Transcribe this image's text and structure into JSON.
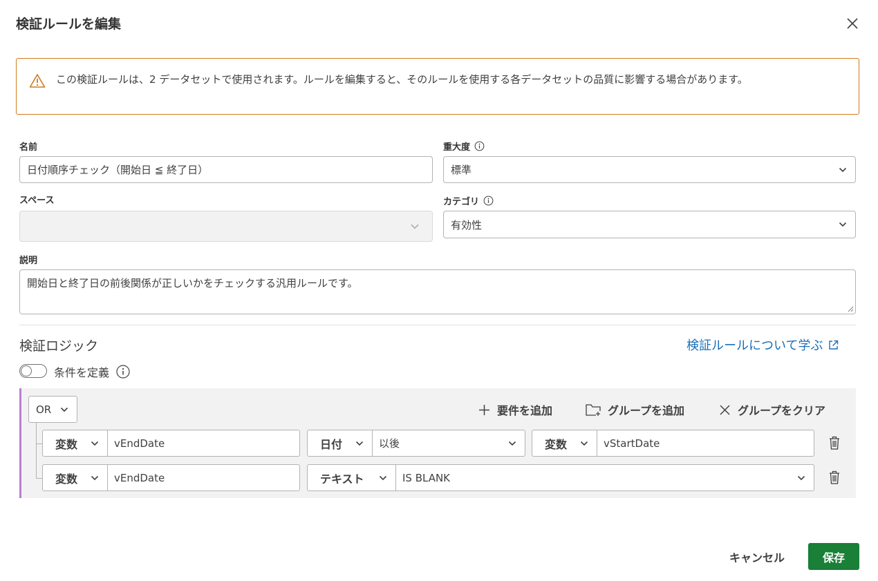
{
  "dialog": {
    "title": "検証ルールを編集"
  },
  "warning": {
    "text": "この検証ルールは、2 データセットで使用されます。ルールを編集すると、そのルールを使用する各データセットの品質に影響する場合があります。"
  },
  "form": {
    "name_label": "名前",
    "name_value": "日付順序チェック（開始日 ≦ 終了日）",
    "severity_label": "重大度",
    "severity_value": "標準",
    "space_label": "スペース",
    "space_value": "",
    "category_label": "カテゴリ",
    "category_value": "有効性",
    "description_label": "説明",
    "description_value": "開始日と終了日の前後関係が正しいかをチェックする汎用ルールです。"
  },
  "logic": {
    "title": "検証ロジック",
    "learn_link": "検証ルールについて学ぶ",
    "toggle_label": "条件を定義",
    "toggle_on": false,
    "operator": "OR",
    "add_requirement": "要件を追加",
    "add_group": "グループを追加",
    "clear_group": "グループをクリア",
    "rows": [
      {
        "left_type": "変数",
        "left_value": "vEndDate",
        "data_type": "日付",
        "comparator": "以後",
        "right_type": "変数",
        "right_value": "vStartDate"
      },
      {
        "left_type": "変数",
        "left_value": "vEndDate",
        "data_type": "テキスト",
        "comparator": "IS BLANK"
      }
    ]
  },
  "footer": {
    "cancel": "キャンセル",
    "save": "保存"
  },
  "colors": {
    "warning_border": "#d07b1a",
    "link": "#1a6fba",
    "save_button": "#1a7f37",
    "group_accent": "#b97fd1"
  }
}
